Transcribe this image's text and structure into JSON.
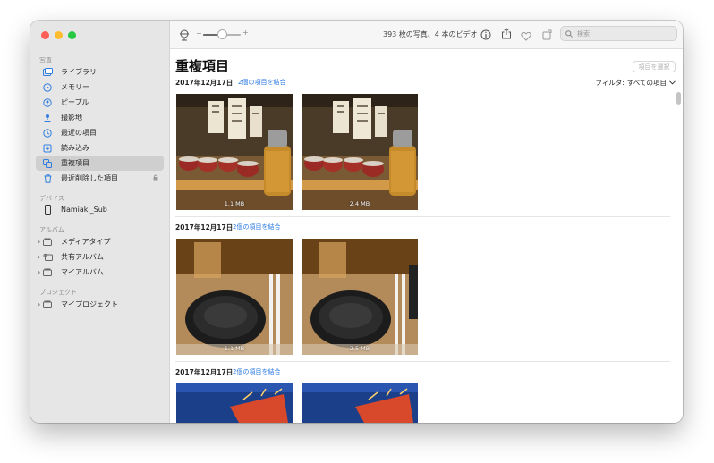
{
  "toolbar": {
    "zoom_minus": "−",
    "zoom_plus": "+",
    "zoom_level": 0.5,
    "count_text": "393 枚の写真、4 本のビデオ",
    "search_placeholder": "検索"
  },
  "sidebar": {
    "sections": {
      "photos": "写真",
      "devices": "デバイス",
      "albums": "アルバム",
      "projects": "プロジェクト"
    },
    "items": [
      {
        "label": "ライブラリ",
        "icon": "library-icon"
      },
      {
        "label": "メモリー",
        "icon": "memories-icon"
      },
      {
        "label": "ピープル",
        "icon": "people-icon"
      },
      {
        "label": "撮影地",
        "icon": "places-icon"
      },
      {
        "label": "最近の項目",
        "icon": "recents-icon"
      },
      {
        "label": "読み込み",
        "icon": "imports-icon"
      },
      {
        "label": "重複項目",
        "icon": "duplicates-icon",
        "selected": true
      },
      {
        "label": "最近削除した項目",
        "icon": "trash-icon"
      }
    ],
    "device": {
      "label": "Namiaki_Sub",
      "icon": "iphone-icon"
    },
    "albums": [
      {
        "label": "メディアタイプ",
        "icon": "album-folder-icon"
      },
      {
        "label": "共有アルバム",
        "icon": "shared-album-icon"
      },
      {
        "label": "マイアルバム",
        "icon": "album-folder-icon"
      }
    ],
    "projects": [
      {
        "label": "マイプロジェクト",
        "icon": "project-folder-icon"
      }
    ]
  },
  "main": {
    "title": "重複項目",
    "select_button": "項目を選択",
    "filter_label": "フィルタ:",
    "filter_value": "すべての項目",
    "groups": [
      {
        "date": "2017年12月17日",
        "merge": "2個の項目を結合",
        "photos": [
          {
            "size": "1.1 MB"
          },
          {
            "size": "2.4 MB"
          }
        ]
      },
      {
        "date": "2017年12月17日",
        "merge": "2個の項目を結合",
        "photos": [
          {
            "size": "1.1 MB"
          },
          {
            "size": "2.5 MB"
          }
        ]
      },
      {
        "date": "2017年12月17日",
        "merge": "2個の項目を結合",
        "photos": [
          {
            "size": ""
          },
          {
            "size": ""
          }
        ]
      }
    ]
  },
  "colors": {
    "accent": "#2a7ae2",
    "sidebar_bg": "#e6e6e6",
    "sidebar_icon": "#2f7de1",
    "traffic_red": "#fe5f57",
    "traffic_yellow": "#febc2e",
    "traffic_green": "#28c840"
  }
}
